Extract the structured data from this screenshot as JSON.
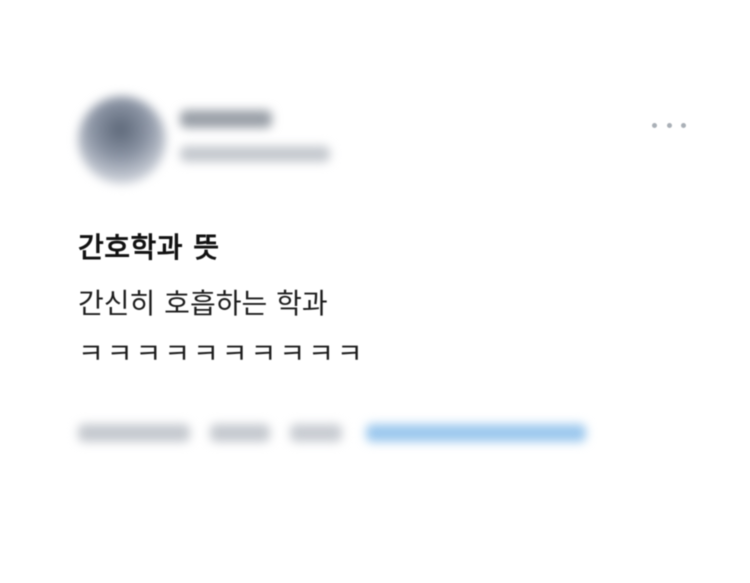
{
  "tweet": {
    "title": "간호학과 뜻",
    "body_lines": [
      "간신히 호흡하는 학과",
      "ㅋㅋㅋㅋㅋㅋㅋㅋㅋㅋ"
    ]
  },
  "author": {
    "avatar_icon": "blurred-profile-avatar"
  },
  "menu": {
    "icon": "more-horizontal-icon"
  },
  "colors": {
    "text_primary": "#111111",
    "text_blur_gray": "#c5c9cf",
    "source_link_blue": "#9cc8ee",
    "menu_dots": "#aab0b7",
    "background": "#ffffff"
  }
}
